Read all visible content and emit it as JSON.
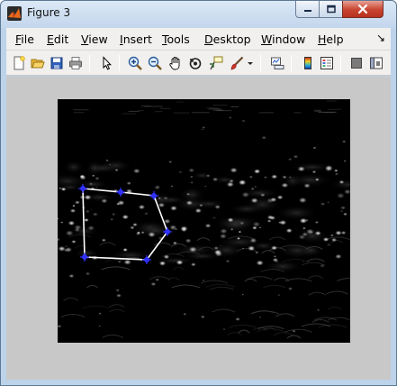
{
  "window": {
    "title": "Figure 3"
  },
  "menu": {
    "items": [
      {
        "id": "file",
        "mnemonic": "F",
        "rest": "ile"
      },
      {
        "id": "edit",
        "mnemonic": "E",
        "rest": "dit"
      },
      {
        "id": "view",
        "mnemonic": "V",
        "rest": "iew"
      },
      {
        "id": "insert",
        "mnemonic": "I",
        "rest": "nsert"
      },
      {
        "id": "tools",
        "mnemonic": "T",
        "rest": "ools"
      },
      {
        "id": "desktop",
        "mnemonic": "D",
        "rest": "esktop"
      },
      {
        "id": "window",
        "mnemonic": "W",
        "rest": "indow"
      },
      {
        "id": "help",
        "mnemonic": "H",
        "rest": "elp"
      }
    ]
  },
  "toolbar": {
    "icons": [
      "new-figure-icon",
      "open-file-icon",
      "save-icon",
      "print-icon",
      "pointer-icon",
      "zoom-in-icon",
      "zoom-out-icon",
      "pan-hand-icon",
      "rotate-3d-icon",
      "data-cursor-icon",
      "brush-icon",
      "link-plot-icon",
      "colorbar-icon",
      "legend-icon",
      "hide-plot-tools-icon",
      "show-plot-tools-icon"
    ]
  },
  "colors": {
    "roi_vertex": "#3030ff",
    "roi_line": "#ffffff",
    "figure_background": "#c8c8c8",
    "axes_background": "#000000"
  }
}
